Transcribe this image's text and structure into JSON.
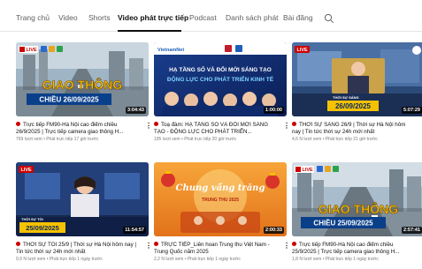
{
  "tabs": [
    {
      "label": "Trang chủ",
      "active": false
    },
    {
      "label": "Video",
      "active": false
    },
    {
      "label": "Shorts",
      "active": false
    },
    {
      "label": "Video phát trực tiếp",
      "active": true
    },
    {
      "label": "Podcast",
      "active": false
    },
    {
      "label": "Danh sách phát",
      "active": false
    },
    {
      "label": "Bài đăng",
      "active": false
    }
  ],
  "search_icon": "search-icon",
  "videos": [
    {
      "badge": "LIVE",
      "overlay_main": "GIAO THÔNG",
      "overlay_sub": "CHIỀU 26/09/2025",
      "duration": "3:04:43",
      "title": "Trực tiếp FM90-Hà Nội cao điểm chiều 26/9/2025 | Trực tiếp camera giao thông H...",
      "meta": "769 lượt xem • Phát trực tiếp 17 giờ trước"
    },
    {
      "badge": "VietnamNet",
      "overlay_main": "HẠ TẦNG SỐ VÀ ĐỔI MỚI SÁNG TẠO",
      "overlay_sub": "ĐỘNG LỰC CHO PHÁT TRIỂN KINH TẾ",
      "duration": "1:00:00",
      "title": "Toạ đàm: HẠ TẦNG SỐ VÀ ĐỔI MỚI SÁNG TẠO - ĐỘNG LỰC CHO PHÁT TRIỂN...",
      "meta": "195 lượt xem • Phát trực tiếp 20 giờ trước"
    },
    {
      "badge": "LIVE",
      "overlay_main": "26/09/2025",
      "overlay_sub": "THỜI SỰ SÁNG",
      "duration": "5:07:29",
      "title": "THỜI SỰ SÁNG 26/9 | Thời sự Hà Nội hôm nay | Tin tức thời sự 24h mới nhất",
      "meta": "4,6 N lượt xem • Phát trực tiếp 21 giờ trước"
    },
    {
      "badge": "LIVE",
      "overlay_main": "25/09/2025",
      "overlay_sub": "THỜI SỰ TỐI",
      "duration": "11:54:57",
      "title": "THỜI SỰ TỐI 25/9 | Thời sự Hà Nội hôm nay | Tin tức thời sự 24h mới nhất",
      "meta": "9,9 N lượt xem • Phát trực tiếp 1 ngày trước"
    },
    {
      "badge": "",
      "overlay_main": "Chung vầng trăng",
      "overlay_sub": "TRUNG THU 2025",
      "duration": "2:00:33",
      "title": "TRỰC TIẾP_Liên hoan Trung thu Việt Nam - Trung Quốc năm 2025",
      "meta": "2,2 N lượt xem • Phát trực tiếp 1 ngày trước"
    },
    {
      "badge": "LIVE",
      "overlay_main": "GIAO THÔNG",
      "overlay_sub": "CHIỀU 25/09/2025",
      "duration": "2:57:41",
      "title": "Trực tiếp FM90-Hà Nội cao điểm chiều 25/9/2025 | Trực tiếp camera giao thông H...",
      "meta": "1,8 N lượt xem • Phát trực tiếp 1 ngày trước"
    }
  ],
  "colors": {
    "live_red": "#cc0000",
    "traffic_yellow": "#f5c200",
    "news_blue": "#1e5fb8",
    "festival_orange": "#f08a1c"
  }
}
